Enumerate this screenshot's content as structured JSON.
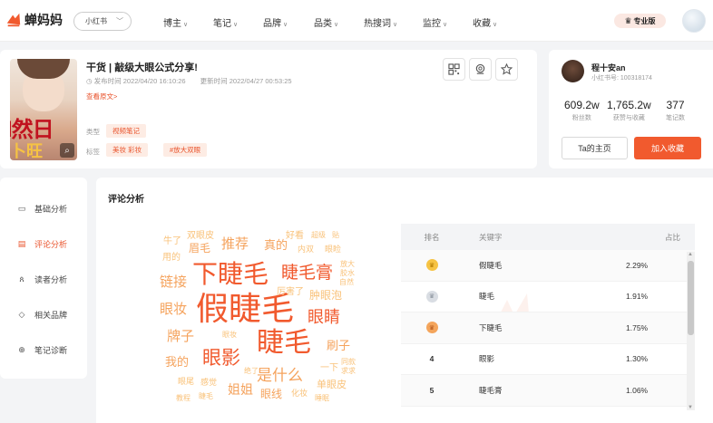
{
  "brand": {
    "name": "蝉妈妈",
    "accent": "#f15a2e"
  },
  "topnav": {
    "platform": "小红书",
    "items": [
      "博主",
      "笔记",
      "品牌",
      "品类",
      "热搜词",
      "监控",
      "收藏"
    ],
    "pro_label": "专业版"
  },
  "note": {
    "title": "干货 | 敲级大眼公式分享!",
    "publish_label": "发布时间",
    "publish_time": "2022/04/20 16:10:26",
    "update_label": "更新时间",
    "update_time": "2022/04/27 00:53:25",
    "view_original": "查看原文>",
    "type_label": "类型",
    "type_value": "视频笔记",
    "tags_label": "标签",
    "tags": [
      "美妆 彩妆",
      "#放大双眼"
    ],
    "thumb_text_main": "l然日",
    "thumb_text_bottom": "卜旺"
  },
  "author": {
    "name": "程十安an",
    "id_text": "小红书号: 100318174",
    "stats": [
      {
        "value": "609.2w",
        "label": "粉丝数"
      },
      {
        "value": "1,765.2w",
        "label": "获赞与收藏"
      },
      {
        "value": "377",
        "label": "笔记数"
      }
    ],
    "home_button": "Ta的主页",
    "fav_button": "加入收藏"
  },
  "side_menu": {
    "items": [
      {
        "label": "基础分析",
        "icon": "monitor-icon"
      },
      {
        "label": "评论分析",
        "icon": "comment-icon"
      },
      {
        "label": "读者分析",
        "icon": "users-icon"
      },
      {
        "label": "相关品牌",
        "icon": "tag-icon"
      },
      {
        "label": "笔记诊断",
        "icon": "diagnose-icon"
      }
    ],
    "active_index": 1
  },
  "comment_analysis": {
    "title": "评论分析",
    "table_headers": {
      "rank": "排名",
      "keyword": "关键字",
      "pct": "占比"
    },
    "rows": [
      {
        "rank": "1",
        "keyword": "假睫毛",
        "pct": "2.29%",
        "medal": "gold"
      },
      {
        "rank": "2",
        "keyword": "睫毛",
        "pct": "1.91%",
        "medal": "silver"
      },
      {
        "rank": "3",
        "keyword": "下睫毛",
        "pct": "1.75%",
        "medal": "bronze"
      },
      {
        "rank": "4",
        "keyword": "眼影",
        "pct": "1.30%",
        "medal": ""
      },
      {
        "rank": "5",
        "keyword": "睫毛膏",
        "pct": "1.06%",
        "medal": ""
      }
    ],
    "wordcloud": {
      "w1": "假睫毛",
      "w2": "下睫毛",
      "w3": "睫毛",
      "w4": "睫毛膏",
      "w5": "眼影",
      "w6": "眼睛",
      "w7": "推荐",
      "w8": "链接",
      "w9": "眼妆",
      "w10": "牌子",
      "w11": "刷子",
      "w12": "是什么",
      "w13": "姐姐",
      "w14": "眼线",
      "w15": "眉毛",
      "w16": "真的",
      "w17": "我的",
      "w18": "用的",
      "w19": "牛了",
      "w20": "双眼皮",
      "w21": "好看",
      "w22": "内双",
      "w23": "眼睑",
      "w24": "厉害了",
      "w25": "肿眼泡",
      "w26": "单眼皮",
      "w27": "化妆",
      "w28": "一下",
      "w29": "感觉",
      "w30": "眼尾",
      "w31": "睫毛",
      "w32": "绝了",
      "w33": "求求",
      "w34": "同款",
      "w35": "放大",
      "w36": "眼妆",
      "w37": "胶水",
      "w38": "自然",
      "w39": "教程",
      "w40": "超级",
      "w41": "睡眠",
      "w42": "贴"
    }
  }
}
